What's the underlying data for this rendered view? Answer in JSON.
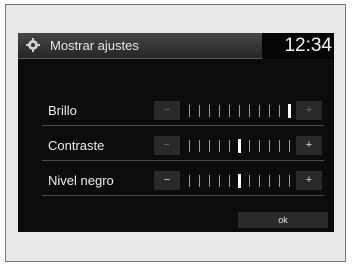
{
  "header": {
    "icon": "settings-icon",
    "title": "Mostrar ajustes",
    "time": "12:34"
  },
  "settings": [
    {
      "label": "Brillo",
      "level": 10,
      "max": 10,
      "minus": "−",
      "plus": "+"
    },
    {
      "label": "Contraste",
      "level": 5,
      "max": 10,
      "minus": "−",
      "plus": "+"
    },
    {
      "label": "Nivel negro",
      "level": 5,
      "max": 10,
      "minus": "−",
      "plus": "+"
    }
  ],
  "footer": {
    "ok_label": "ok"
  }
}
